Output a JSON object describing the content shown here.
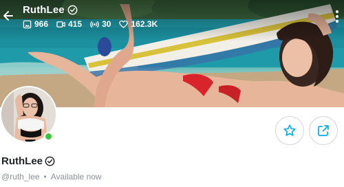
{
  "profile": {
    "display_name": "RuthLee",
    "username": "@ruth_lee",
    "status": "Available now",
    "online": true
  },
  "stats": {
    "photos": "966",
    "videos": "415",
    "streams": "30",
    "likes": "162.3K"
  },
  "icons": {
    "back": "arrow-left-icon",
    "verified": "verified-badge-icon",
    "photos": "image-icon",
    "videos": "video-icon",
    "streams": "broadcast-icon",
    "likes": "heart-icon",
    "menu": "kebab-menu-icon",
    "favorite": "star-icon",
    "share": "share-icon"
  },
  "colors": {
    "accent": "#00aff0",
    "online": "#3ac53a",
    "text_primary": "#1f2326",
    "text_secondary": "#8a9197"
  }
}
